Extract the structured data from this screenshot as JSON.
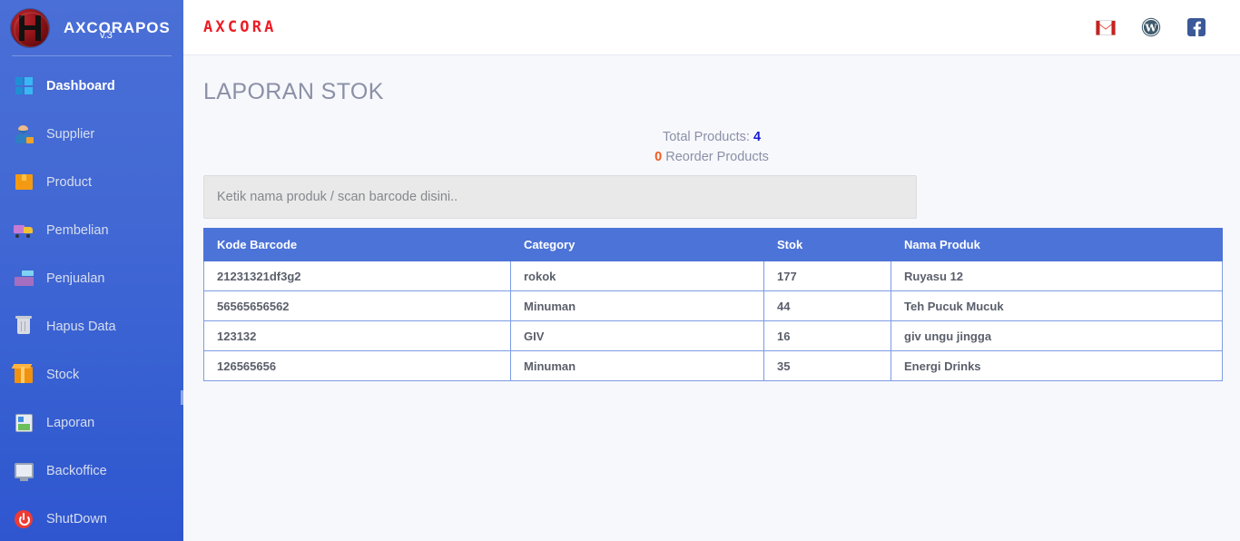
{
  "sidebar": {
    "brand": {
      "title": "AXCORAPOS",
      "version": "v.3",
      "logo_icon": "app-logo-icon"
    },
    "items": [
      {
        "label": "Dashboard",
        "icon": "windows-icon",
        "active": true
      },
      {
        "label": "Supplier",
        "icon": "supplier-person-icon",
        "active": false
      },
      {
        "label": "Product",
        "icon": "box-icon",
        "active": false
      },
      {
        "label": "Pembelian",
        "icon": "delivery-truck-icon",
        "active": false
      },
      {
        "label": "Penjualan",
        "icon": "cash-register-icon",
        "active": false
      },
      {
        "label": "Hapus Data",
        "icon": "trash-icon",
        "active": false
      },
      {
        "label": "Stock",
        "icon": "package-box-icon",
        "active": false
      },
      {
        "label": "Laporan",
        "icon": "report-clipboard-icon",
        "active": false
      },
      {
        "label": "Backoffice",
        "icon": "monitor-icon",
        "active": false
      },
      {
        "label": "ShutDown",
        "icon": "power-icon",
        "active": false
      }
    ]
  },
  "topbar": {
    "logo_text": "AXCORA",
    "icons": [
      {
        "name": "gmail-icon",
        "label": "Gmail"
      },
      {
        "name": "wordpress-icon",
        "label": "WordPress"
      },
      {
        "name": "facebook-icon",
        "label": "Facebook"
      }
    ]
  },
  "page": {
    "title": "LAPORAN STOK"
  },
  "stats": {
    "total_label": "Total Products:",
    "total_value": "4",
    "reorder_value": "0",
    "reorder_label": "Reorder Products"
  },
  "search": {
    "placeholder": "Ketik nama produk / scan barcode disini..",
    "value": ""
  },
  "table": {
    "columns": [
      "Kode Barcode",
      "Category",
      "Stok",
      "Nama Produk"
    ],
    "rows": [
      {
        "barcode": "21231321df3g2",
        "category": "rokok",
        "stok": "177",
        "nama": "Ruyasu 12"
      },
      {
        "barcode": "56565656562",
        "category": "Minuman",
        "stok": "44",
        "nama": "Teh Pucuk Mucuk"
      },
      {
        "barcode": "123132",
        "category": "GIV",
        "stok": "16",
        "nama": "giv ungu jingga"
      },
      {
        "barcode": "126565656",
        "category": "Minuman",
        "stok": "35",
        "nama": "Energi Drinks"
      }
    ]
  },
  "colors": {
    "sidebar_top": "#4a6fd6",
    "sidebar_bottom": "#2f56cf",
    "table_header": "#4c73d8",
    "brand_red": "#ed1c24",
    "total_blue": "#1a1ad6",
    "reorder_orange": "#f25a1e",
    "content_bg": "#f7f8fc"
  }
}
